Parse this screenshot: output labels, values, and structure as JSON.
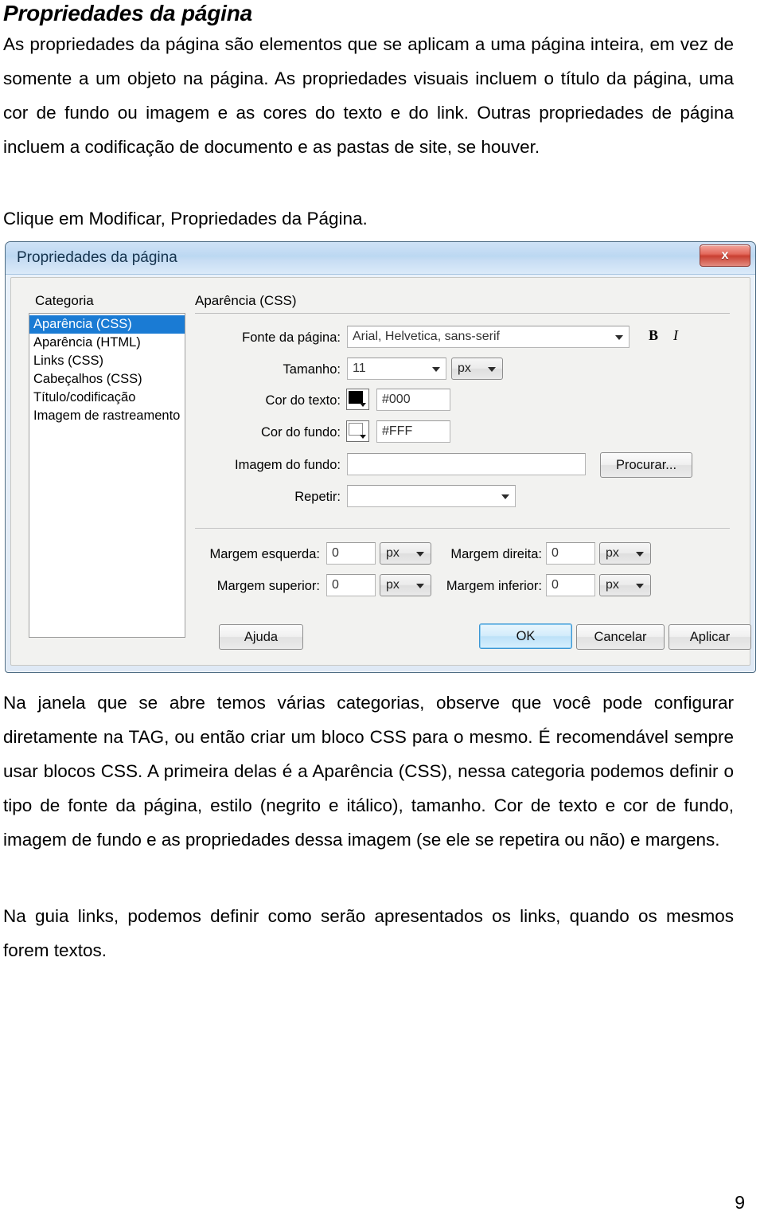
{
  "document": {
    "heading": "Propriedades da página",
    "paragraph_1": "As propriedades da página são elementos que se aplicam a uma página inteira, em vez de somente a um objeto na página. As propriedades visuais incluem o título da página, uma cor de fundo ou imagem e as cores do texto e do link. Outras propriedades de página incluem a codificação de documento e as pastas de site, se houver.",
    "paragraph_2": "Clique em Modificar, Propriedades da Página.",
    "paragraph_3": "Na janela que se abre temos várias categorias, observe que você pode configurar diretamente na TAG, ou então criar um bloco CSS para o mesmo. É recomendável sempre usar blocos CSS. A primeira delas é a Aparência (CSS), nessa categoria podemos definir o tipo de fonte da página, estilo (negrito e itálico), tamanho. Cor de texto e cor de fundo, imagem de fundo e as propriedades dessa imagem (se ele se repetira ou não) e margens.",
    "paragraph_4": "Na guia links, podemos definir como serão apresentados os links, quando os mesmos forem textos.",
    "page_number": "9"
  },
  "dialog": {
    "title": "Propriedades da página",
    "close_label": "x",
    "category_label": "Categoria",
    "pane_title": "Aparência (CSS)",
    "categories": [
      {
        "label": "Aparência (CSS)",
        "selected": true
      },
      {
        "label": "Aparência (HTML)",
        "selected": false
      },
      {
        "label": "Links (CSS)",
        "selected": false
      },
      {
        "label": "Cabeçalhos (CSS)",
        "selected": false
      },
      {
        "label": "Título/codificação",
        "selected": false
      },
      {
        "label": "Imagem de rastreamento",
        "selected": false
      }
    ],
    "fields": {
      "font_label": "Fonte da página:",
      "font_value": "Arial, Helvetica, sans-serif",
      "bold_label": "B",
      "italic_label": "I",
      "size_label": "Tamanho:",
      "size_value": "11",
      "size_unit": "px",
      "text_color_label": "Cor do texto:",
      "text_color_value": "#000",
      "text_color_swatch": "#000000",
      "bg_color_label": "Cor do fundo:",
      "bg_color_value": "#FFF",
      "bg_color_swatch": "#FFFFFF",
      "bg_image_label": "Imagem do fundo:",
      "bg_image_value": "",
      "browse_label": "Procurar...",
      "repeat_label": "Repetir:",
      "repeat_value": "",
      "margin_left_label": "Margem esquerda:",
      "margin_left_value": "0",
      "margin_left_unit": "px",
      "margin_right_label": "Margem direita:",
      "margin_right_value": "0",
      "margin_right_unit": "px",
      "margin_top_label": "Margem superior:",
      "margin_top_value": "0",
      "margin_top_unit": "px",
      "margin_bottom_label": "Margem inferior:",
      "margin_bottom_value": "0",
      "margin_bottom_unit": "px"
    },
    "buttons": {
      "help": "Ajuda",
      "ok": "OK",
      "cancel": "Cancelar",
      "apply": "Aplicar"
    }
  }
}
